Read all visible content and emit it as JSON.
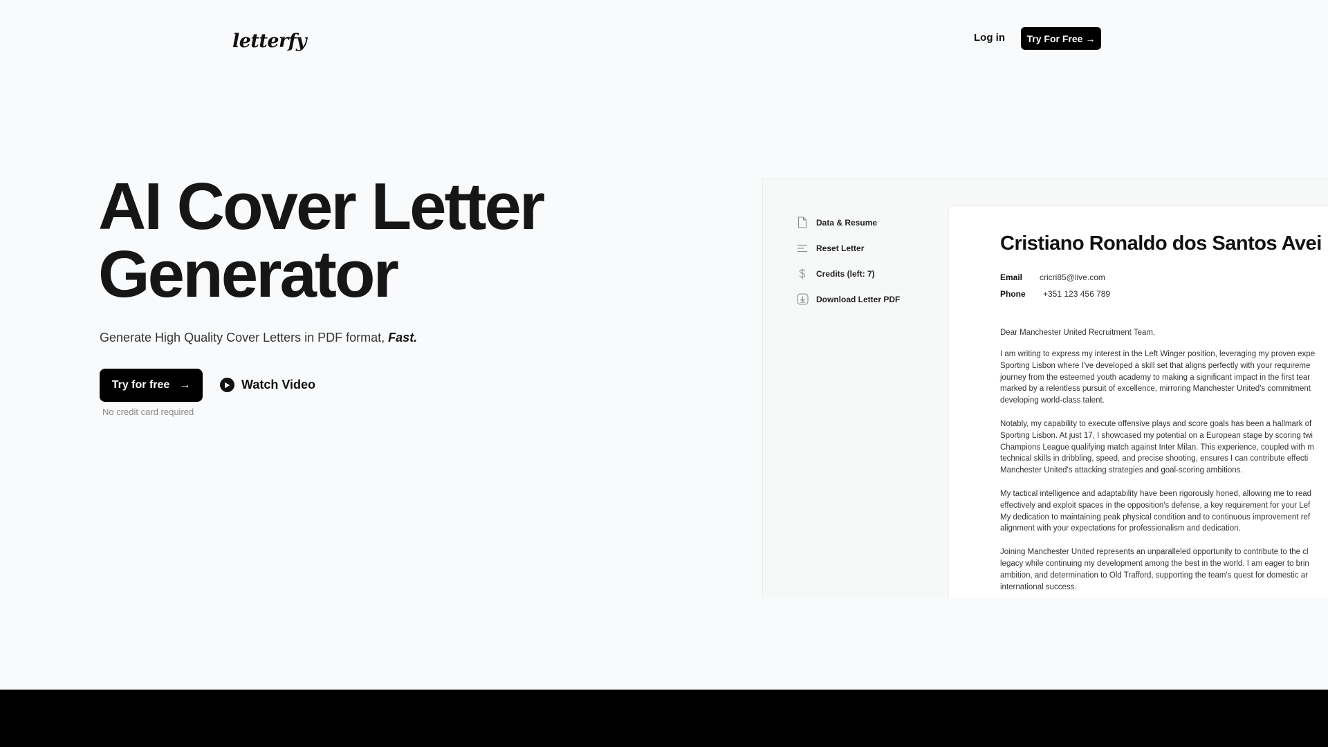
{
  "header": {
    "logo": "letterfy",
    "login_label": "Log in",
    "cta_label": "Try For Free",
    "cta_arrow": "→"
  },
  "hero": {
    "title_line1": "AI Cover Letter",
    "title_line2": "Generator",
    "subtitle_prefix": "Generate High Quality Cover Letters in PDF format, ",
    "subtitle_emphasis": "Fast.",
    "primary_cta_label": "Try for free",
    "primary_cta_arrow": "→",
    "no_credit_card": "No credit card required",
    "watch_video_label": "Watch Video"
  },
  "preview": {
    "menu": [
      {
        "label": "Data & Resume",
        "icon": "document-icon"
      },
      {
        "label": "Reset Letter",
        "icon": "lines-icon"
      },
      {
        "label": "Credits (left: 7)",
        "icon": "dollar-icon"
      },
      {
        "label": "Download Letter PDF",
        "icon": "download-icon"
      }
    ],
    "letter": {
      "name": "Cristiano Ronaldo dos Santos Avei",
      "email_label": "Email",
      "email_value": "cricri85@live.com",
      "phone_label": "Phone",
      "phone_value": "+351 123 456 789",
      "salutation": "Dear Manchester United Recruitment Team,",
      "paragraphs": [
        [
          "I am writing to express my interest in the Left Winger position, leveraging my proven expe",
          "Sporting Lisbon where I've developed a skill set that aligns perfectly with your requireme",
          "journey from the esteemed youth academy to making a significant impact in the first tear",
          "marked by a relentless pursuit of excellence, mirroring Manchester United's commitment",
          "developing world-class talent."
        ],
        [
          "Notably, my capability to execute offensive plays and score goals has been a hallmark of",
          "Sporting Lisbon. At just 17, I showcased my potential on a European stage by scoring twi",
          "Champions League qualifying match against Inter Milan. This experience, coupled with m",
          "technical skills in dribbling, speed, and precise shooting, ensures I can contribute effecti",
          "Manchester United's attacking strategies and goal-scoring ambitions."
        ],
        [
          "My tactical intelligence and adaptability have been rigorously honed, allowing me to read",
          "effectively and exploit spaces in the opposition's defense, a key requirement for your Lef",
          "My dedication to maintaining peak physical condition and to continuous improvement ref",
          "alignment with your expectations for professionalism and dedication."
        ],
        [
          "Joining Manchester United represents an unparalleled opportunity to contribute to the cl",
          "legacy while continuing my development among the best in the world. I am eager to brin",
          "ambition, and determination to Old Trafford, supporting the team's quest for domestic ar",
          "international success."
        ]
      ]
    }
  }
}
